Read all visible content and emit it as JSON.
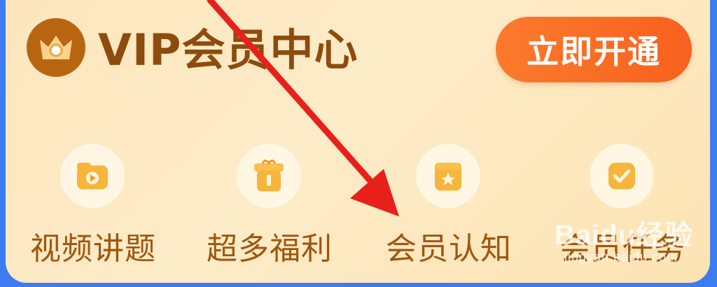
{
  "header": {
    "title": "VIP会员中心",
    "open_button_label": "立即开通",
    "crown_icon": "crown-icon"
  },
  "features": [
    {
      "label": "视频讲题",
      "icon": "video-play-icon"
    },
    {
      "label": "超多福利",
      "icon": "gift-icon"
    },
    {
      "label": "会员认知",
      "icon": "member-star-icon"
    },
    {
      "label": "会员任务",
      "icon": "task-check-icon"
    }
  ],
  "watermark": {
    "brand": "Baidu经验",
    "url": "jingyan.baidu.com"
  },
  "colors": {
    "card_bg": "#fde6bd",
    "title": "#8e4b0e",
    "button": "#fb7a2c",
    "label": "#a0560f",
    "arrow": "#e8201a",
    "edge": "#3d7cf0"
  }
}
